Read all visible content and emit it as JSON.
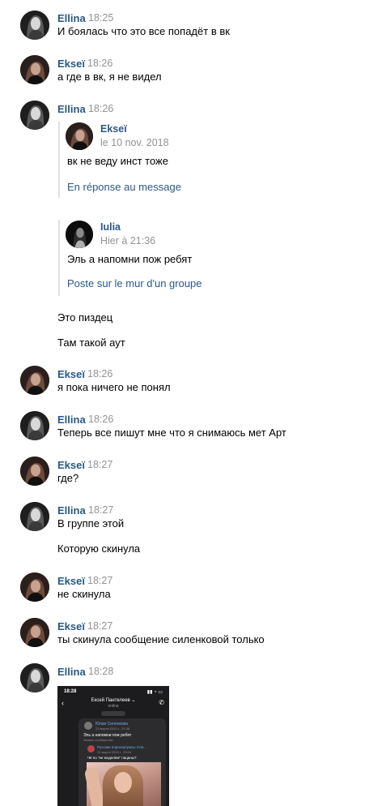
{
  "messages": [
    {
      "name": "Ellina",
      "time": "18:25",
      "text": "И боялась что это все попадёт в вк"
    },
    {
      "name": "Ekseï",
      "time": "18:26",
      "text": "а где в вк, я не видел"
    },
    {
      "name": "Ellina",
      "time": "18:26"
    },
    {
      "name": "Ekseï",
      "time": "18:26",
      "text": "я пока ничего не понял"
    },
    {
      "name": "Ellina",
      "time": "18:26",
      "text": "Теперь все пишут мне что я снимаюсь мет Арт"
    },
    {
      "name": "Ekseï",
      "time": "18:27",
      "text": "где?"
    },
    {
      "name": "Ellina",
      "time": "18:27",
      "text": "В группе этой"
    },
    {
      "name": "Ekseï",
      "time": "18:27",
      "text": "не скинула"
    },
    {
      "name": "Ekseï",
      "time": "18:27",
      "text": "ты скинула сообщение силенковой только"
    },
    {
      "name": "Ellina",
      "time": "18:28"
    }
  ],
  "quotes": [
    {
      "name": "Ekseï",
      "date": "le 10 nov. 2018",
      "text": "вк не веду инст тоже",
      "link": "En réponse au message"
    },
    {
      "name": "Iulia",
      "date": "Hier à 21:36",
      "text": "Эль а напомни пож ребят",
      "link": "Poste sur le mur d'un groupe"
    }
  ],
  "continuations": [
    "Это пиздец",
    "Там такой аут",
    "Которую скинула"
  ],
  "attachment": {
    "status_time": "18:28",
    "chat_title": "Ексей Пантелеев ⌄",
    "chat_status": "online",
    "inner_name": "Юлия Силенкова",
    "inner_date": "23 марта 2020 г., 21:36",
    "inner_text": "Эль а напомни пож ребят",
    "inner_link": "Запись сообщества",
    "group_name": "Русские порноактрисы  Сли...",
    "group_date": "22 марта 2020 г., 20:04",
    "group_text": "Чё по \"не моделям\" пацаны?"
  },
  "colors": {
    "name": "#2a5885",
    "time": "#939393",
    "link": "#2a5885"
  }
}
